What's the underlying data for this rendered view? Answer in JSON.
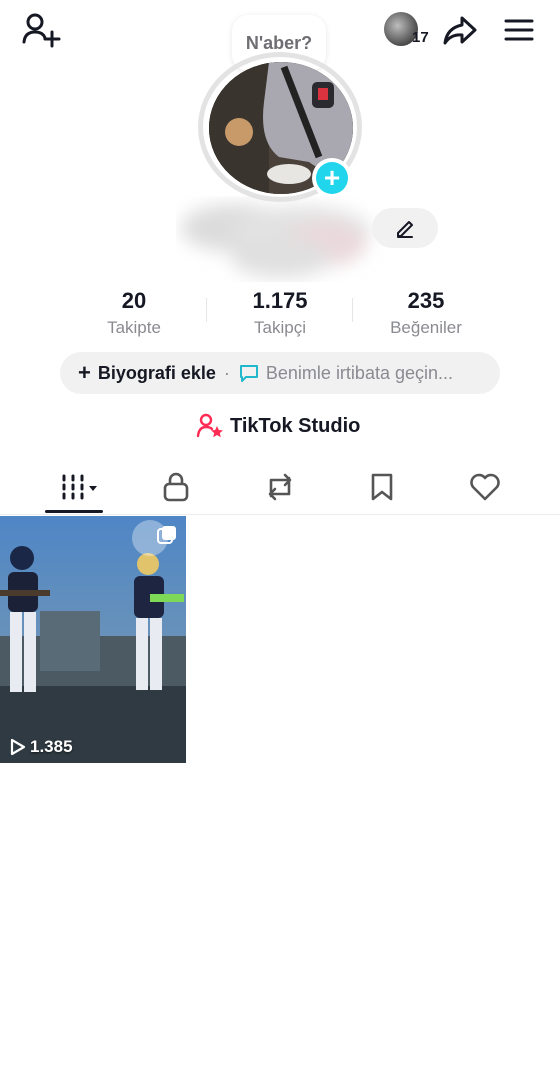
{
  "header": {
    "note_text": "N'aber?",
    "mini_avatar_count": "17"
  },
  "stats": [
    {
      "value": "20",
      "label": "Takipte"
    },
    {
      "value": "1.175",
      "label": "Takipçi"
    },
    {
      "value": "235",
      "label": "Beğeniler"
    }
  ],
  "bio": {
    "add_label": "Biyografi ekle",
    "separator": "·",
    "contact_label": "Benimle irtibata geçin..."
  },
  "studio": {
    "label": "TikTok Studio"
  },
  "tabs": [
    {
      "icon": "grid-icon",
      "active": true
    },
    {
      "icon": "lock-icon",
      "active": false
    },
    {
      "icon": "repost-icon",
      "active": false
    },
    {
      "icon": "bookmark-icon",
      "active": false
    },
    {
      "icon": "heart-icon",
      "active": false
    }
  ],
  "videos": [
    {
      "views": "1.385"
    }
  ],
  "colors": {
    "accent": "#20d5ec",
    "studio_icon": "#fe2c55",
    "text": "#161823",
    "secondary": "#8a8b91"
  }
}
